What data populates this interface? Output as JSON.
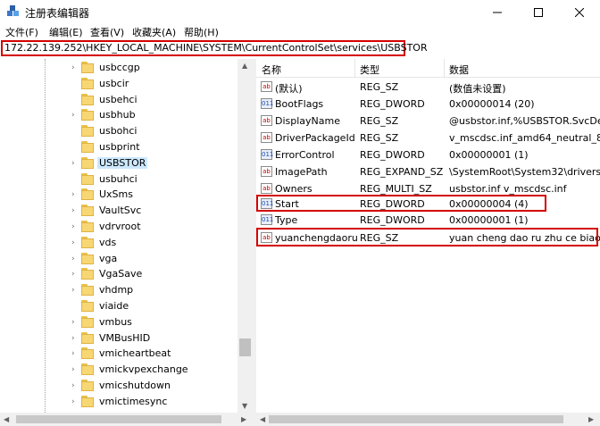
{
  "window": {
    "title": "注册表编辑器",
    "icon": "registry-editor-icon",
    "controls": [
      "minimize",
      "maximize",
      "close"
    ]
  },
  "menu": [
    "文件(F)",
    "编辑(E)",
    "查看(V)",
    "收藏夹(A)",
    "帮助(H)"
  ],
  "address": "172.22.139.252\\HKEY_LOCAL_MACHINE\\SYSTEM\\CurrentControlSet\\services\\USBSTOR",
  "tree": {
    "items": [
      {
        "label": "usbccgp",
        "expandable": true,
        "selected": false
      },
      {
        "label": "usbcir",
        "expandable": false,
        "selected": false
      },
      {
        "label": "usbehci",
        "expandable": false,
        "selected": false
      },
      {
        "label": "usbhub",
        "expandable": true,
        "selected": false
      },
      {
        "label": "usbohci",
        "expandable": false,
        "selected": false
      },
      {
        "label": "usbprint",
        "expandable": false,
        "selected": false
      },
      {
        "label": "USBSTOR",
        "expandable": true,
        "selected": true
      },
      {
        "label": "usbuhci",
        "expandable": false,
        "selected": false
      },
      {
        "label": "UxSms",
        "expandable": true,
        "selected": false
      },
      {
        "label": "VaultSvc",
        "expandable": true,
        "selected": false
      },
      {
        "label": "vdrvroot",
        "expandable": true,
        "selected": false
      },
      {
        "label": "vds",
        "expandable": true,
        "selected": false
      },
      {
        "label": "vga",
        "expandable": true,
        "selected": false
      },
      {
        "label": "VgaSave",
        "expandable": true,
        "selected": false
      },
      {
        "label": "vhdmp",
        "expandable": true,
        "selected": false
      },
      {
        "label": "viaide",
        "expandable": false,
        "selected": false
      },
      {
        "label": "vmbus",
        "expandable": true,
        "selected": false
      },
      {
        "label": "VMBusHID",
        "expandable": true,
        "selected": false
      },
      {
        "label": "vmicheartbeat",
        "expandable": true,
        "selected": false
      },
      {
        "label": "vmickvpexchange",
        "expandable": true,
        "selected": false
      },
      {
        "label": "vmicshutdown",
        "expandable": true,
        "selected": false
      },
      {
        "label": "vmictimesync",
        "expandable": true,
        "selected": false
      }
    ]
  },
  "list": {
    "columns": [
      "名称",
      "类型",
      "数据"
    ],
    "rows": [
      {
        "icon": "ab",
        "name": "(默认)",
        "type": "REG_SZ",
        "data": "(数值未设置)"
      },
      {
        "icon": "bin",
        "name": "BootFlags",
        "type": "REG_DWORD",
        "data": "0x00000014 (20)"
      },
      {
        "icon": "ab",
        "name": "DisplayName",
        "type": "REG_SZ",
        "data": "@usbstor.inf,%USBSTOR.SvcDes"
      },
      {
        "icon": "ab",
        "name": "DriverPackageId",
        "type": "REG_SZ",
        "data": "v_mscdsc.inf_amd64_neutral_8b1"
      },
      {
        "icon": "bin",
        "name": "ErrorControl",
        "type": "REG_DWORD",
        "data": "0x00000001 (1)"
      },
      {
        "icon": "ab",
        "name": "ImagePath",
        "type": "REG_EXPAND_SZ",
        "data": "\\SystemRoot\\System32\\drivers\\U"
      },
      {
        "icon": "ab",
        "name": "Owners",
        "type": "REG_MULTI_SZ",
        "data": "usbstor.inf v_mscdsc.inf"
      },
      {
        "icon": "bin",
        "name": "Start",
        "type": "REG_DWORD",
        "data": "0x00000004 (4)"
      },
      {
        "icon": "bin",
        "name": "Type",
        "type": "REG_DWORD",
        "data": "0x00000001 (1)"
      },
      {
        "icon": "ab",
        "name": "yuanchengdaoru",
        "type": "REG_SZ",
        "data": "yuan cheng dao ru zhu ce biao"
      }
    ]
  },
  "icons": {
    "string_value": "ab",
    "binary_value": "011"
  },
  "colors": {
    "highlight": "#d40000",
    "selection": "#cce8ff"
  }
}
